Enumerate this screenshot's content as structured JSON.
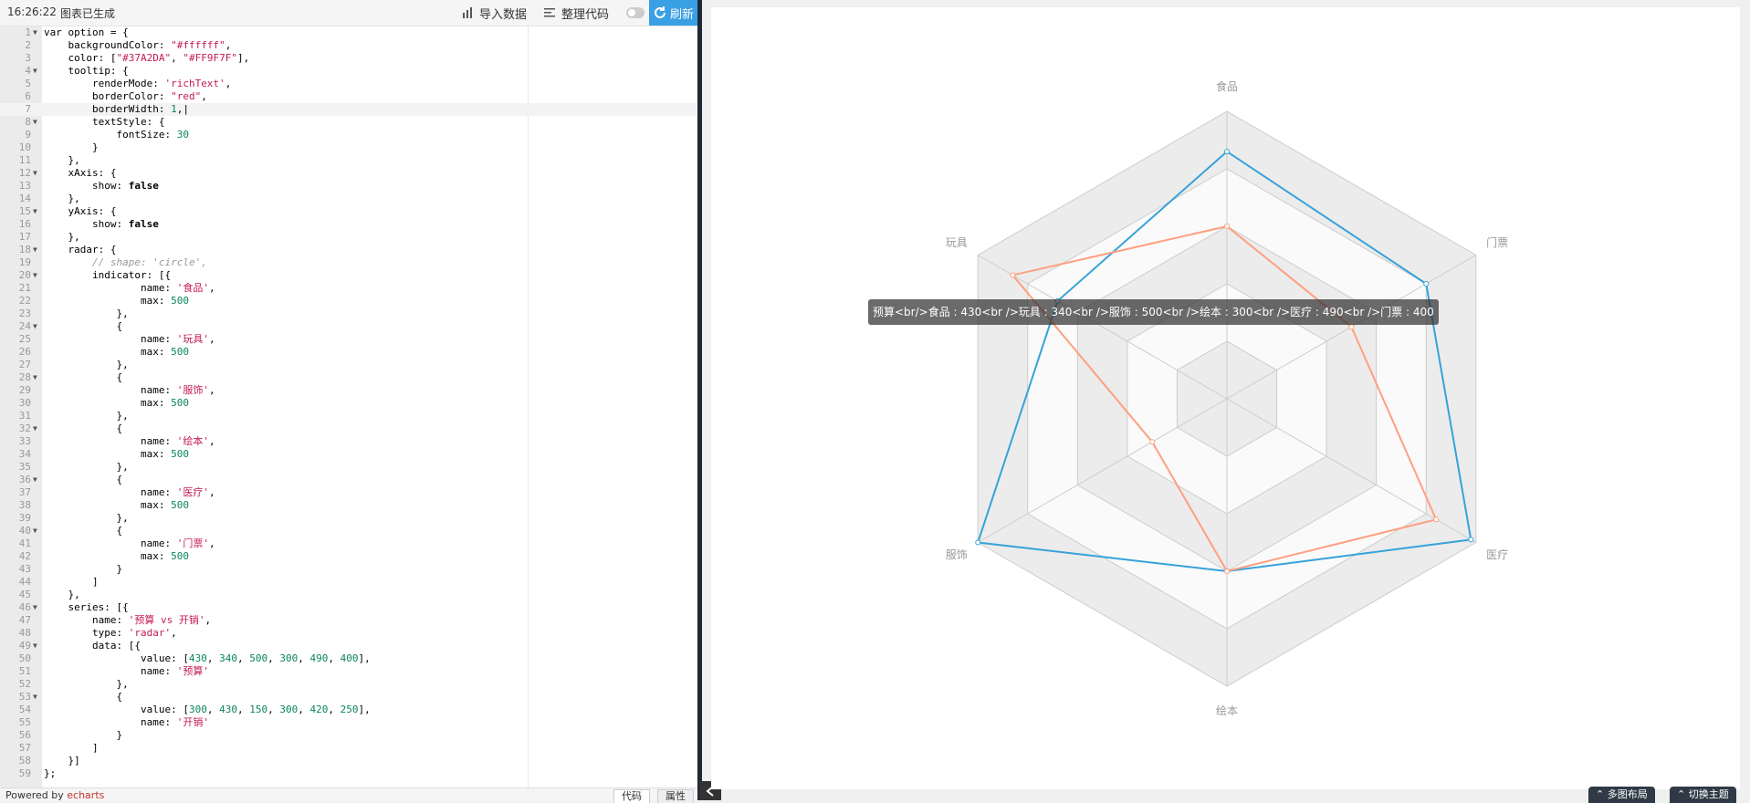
{
  "toolbar": {
    "time": "16:26:22",
    "status": "图表已生成",
    "import_label": "导入数据",
    "format_label": "整理代码",
    "refresh_label": "刷新"
  },
  "footer": {
    "powered_prefix": "Powered by ",
    "powered_link": "echarts",
    "tab_code": "代码",
    "tab_props": "属性"
  },
  "bottom_buttons": {
    "layout": "多图布局",
    "theme": "切换主题"
  },
  "chart_data": {
    "type": "radar",
    "indicators": [
      "食品",
      "玩具",
      "服饰",
      "绘本",
      "医疗",
      "门票"
    ],
    "max": 500,
    "series": [
      {
        "name": "预算",
        "values": [
          430,
          340,
          500,
          300,
          490,
          400
        ],
        "color": "#37A2DA"
      },
      {
        "name": "开销",
        "values": [
          300,
          430,
          150,
          300,
          420,
          250
        ],
        "color": "#FF9F7F"
      }
    ],
    "split_number": 5,
    "tooltip_text": "预算<br/>食品 : 430<br />玩具 : 340<br />服饰 : 500<br />绘本 : 300<br />医疗 : 490<br />门票 : 400"
  },
  "code_lines": [
    {
      "n": 1,
      "fold": true,
      "h": "var option = {"
    },
    {
      "n": 2,
      "fold": false,
      "h": "    backgroundColor: <span class=\"str\">\"#ffffff\"</span>,"
    },
    {
      "n": 3,
      "fold": false,
      "h": "    color: [<span class=\"str\">\"#37A2DA\"</span>, <span class=\"str\">\"#FF9F7F\"</span>],"
    },
    {
      "n": 4,
      "fold": true,
      "h": "    tooltip: {"
    },
    {
      "n": 5,
      "fold": false,
      "h": "        renderMode: <span class=\"str\">'richText'</span>,"
    },
    {
      "n": 6,
      "fold": false,
      "h": "        borderColor: <span class=\"str\">\"red\"</span>,"
    },
    {
      "n": 7,
      "fold": false,
      "h": "        borderWidth: <span class=\"num\">1</span>,|",
      "active": true
    },
    {
      "n": 8,
      "fold": true,
      "h": "        textStyle: {"
    },
    {
      "n": 9,
      "fold": false,
      "h": "            fontSize: <span class=\"num\">30</span>"
    },
    {
      "n": 10,
      "fold": false,
      "h": "        }"
    },
    {
      "n": 11,
      "fold": false,
      "h": "    },"
    },
    {
      "n": 12,
      "fold": true,
      "h": "    xAxis: {"
    },
    {
      "n": 13,
      "fold": false,
      "h": "        show: <span class=\"kw\">false</span>"
    },
    {
      "n": 14,
      "fold": false,
      "h": "    },"
    },
    {
      "n": 15,
      "fold": true,
      "h": "    yAxis: {"
    },
    {
      "n": 16,
      "fold": false,
      "h": "        show: <span class=\"kw\">false</span>"
    },
    {
      "n": 17,
      "fold": false,
      "h": "    },"
    },
    {
      "n": 18,
      "fold": true,
      "h": "    radar: {"
    },
    {
      "n": 19,
      "fold": false,
      "h": "        <span class=\"cm\">// shape: 'circle',</span>"
    },
    {
      "n": 20,
      "fold": true,
      "h": "        indicator: [{"
    },
    {
      "n": 21,
      "fold": false,
      "h": "                name: <span class=\"str\">'食品'</span>,"
    },
    {
      "n": 22,
      "fold": false,
      "h": "                max: <span class=\"num\">500</span>"
    },
    {
      "n": 23,
      "fold": false,
      "h": "            },"
    },
    {
      "n": 24,
      "fold": true,
      "h": "            {"
    },
    {
      "n": 25,
      "fold": false,
      "h": "                name: <span class=\"str\">'玩具'</span>,"
    },
    {
      "n": 26,
      "fold": false,
      "h": "                max: <span class=\"num\">500</span>"
    },
    {
      "n": 27,
      "fold": false,
      "h": "            },"
    },
    {
      "n": 28,
      "fold": true,
      "h": "            {"
    },
    {
      "n": 29,
      "fold": false,
      "h": "                name: <span class=\"str\">'服饰'</span>,"
    },
    {
      "n": 30,
      "fold": false,
      "h": "                max: <span class=\"num\">500</span>"
    },
    {
      "n": 31,
      "fold": false,
      "h": "            },"
    },
    {
      "n": 32,
      "fold": true,
      "h": "            {"
    },
    {
      "n": 33,
      "fold": false,
      "h": "                name: <span class=\"str\">'绘本'</span>,"
    },
    {
      "n": 34,
      "fold": false,
      "h": "                max: <span class=\"num\">500</span>"
    },
    {
      "n": 35,
      "fold": false,
      "h": "            },"
    },
    {
      "n": 36,
      "fold": true,
      "h": "            {"
    },
    {
      "n": 37,
      "fold": false,
      "h": "                name: <span class=\"str\">'医疗'</span>,"
    },
    {
      "n": 38,
      "fold": false,
      "h": "                max: <span class=\"num\">500</span>"
    },
    {
      "n": 39,
      "fold": false,
      "h": "            },"
    },
    {
      "n": 40,
      "fold": true,
      "h": "            {"
    },
    {
      "n": 41,
      "fold": false,
      "h": "                name: <span class=\"str\">'门票'</span>,"
    },
    {
      "n": 42,
      "fold": false,
      "h": "                max: <span class=\"num\">500</span>"
    },
    {
      "n": 43,
      "fold": false,
      "h": "            }"
    },
    {
      "n": 44,
      "fold": false,
      "h": "        ]"
    },
    {
      "n": 45,
      "fold": false,
      "h": "    },"
    },
    {
      "n": 46,
      "fold": true,
      "h": "    series: [{"
    },
    {
      "n": 47,
      "fold": false,
      "h": "        name: <span class=\"str\">'预算 vs 开销'</span>,"
    },
    {
      "n": 48,
      "fold": false,
      "h": "        type: <span class=\"str\">'radar'</span>,"
    },
    {
      "n": 49,
      "fold": true,
      "h": "        data: [{"
    },
    {
      "n": 50,
      "fold": false,
      "h": "                value: [<span class=\"num\">430</span>, <span class=\"num\">340</span>, <span class=\"num\">500</span>, <span class=\"num\">300</span>, <span class=\"num\">490</span>, <span class=\"num\">400</span>],"
    },
    {
      "n": 51,
      "fold": false,
      "h": "                name: <span class=\"str\">'预算'</span>"
    },
    {
      "n": 52,
      "fold": false,
      "h": "            },"
    },
    {
      "n": 53,
      "fold": true,
      "h": "            {"
    },
    {
      "n": 54,
      "fold": false,
      "h": "                value: [<span class=\"num\">300</span>, <span class=\"num\">430</span>, <span class=\"num\">150</span>, <span class=\"num\">300</span>, <span class=\"num\">420</span>, <span class=\"num\">250</span>],"
    },
    {
      "n": 55,
      "fold": false,
      "h": "                name: <span class=\"str\">'开销'</span>"
    },
    {
      "n": 56,
      "fold": false,
      "h": "            }"
    },
    {
      "n": 57,
      "fold": false,
      "h": "        ]"
    },
    {
      "n": 58,
      "fold": false,
      "h": "    }]"
    },
    {
      "n": 59,
      "fold": false,
      "h": "};"
    }
  ]
}
